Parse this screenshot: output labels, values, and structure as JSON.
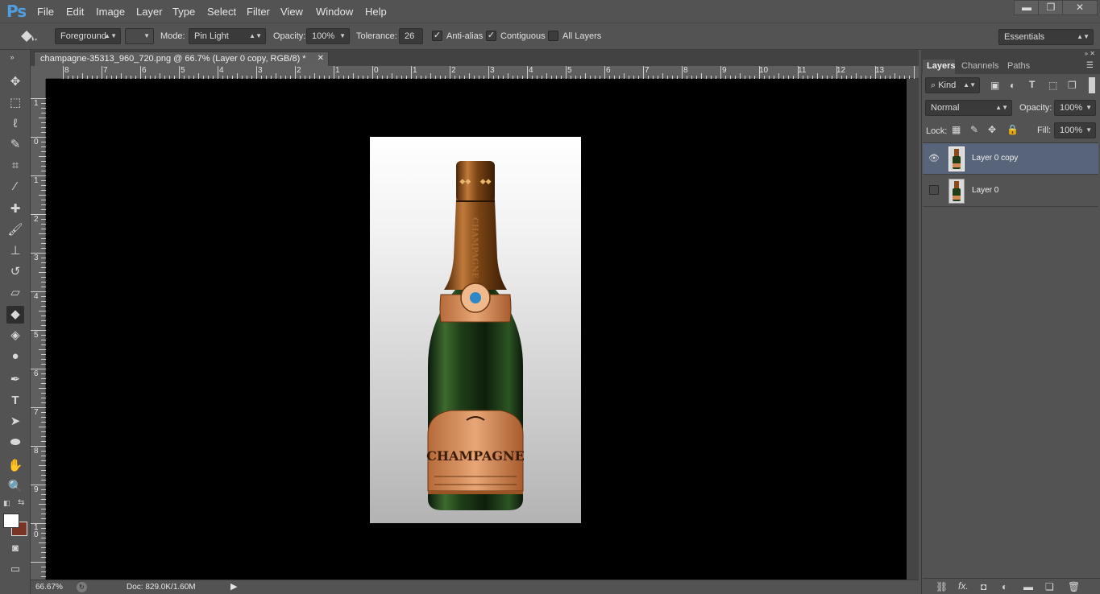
{
  "app": {
    "logo": "Ps"
  },
  "menu": [
    "File",
    "Edit",
    "Image",
    "Layer",
    "Type",
    "Select",
    "Filter",
    "View",
    "Window",
    "Help"
  ],
  "window_controls": {
    "minimize": "▬",
    "restore": "❐",
    "close": "✕"
  },
  "options": {
    "tool_icon": "paint-bucket-icon",
    "fill_source": "Foreground",
    "mode_label": "Mode:",
    "mode_value": "Pin Light",
    "opacity_label": "Opacity:",
    "opacity_value": "100%",
    "tolerance_label": "Tolerance:",
    "tolerance_value": "26",
    "antialias_label": "Anti-alias",
    "antialias_checked": true,
    "contiguous_label": "Contiguous",
    "contiguous_checked": true,
    "all_layers_label": "All Layers",
    "all_layers_checked": false,
    "workspace": "Essentials"
  },
  "document_tab": {
    "title": "champagne-35313_960_720.png @ 66.7% (Layer 0 copy, RGB/8) *",
    "close": "✕"
  },
  "ruler_top": [
    "8",
    "7",
    "6",
    "5",
    "4",
    "3",
    "2",
    "1",
    "0",
    "1",
    "2",
    "3",
    "4",
    "5",
    "6",
    "7",
    "8",
    "9",
    "10",
    "11",
    "12",
    "13"
  ],
  "ruler_left": [
    "1",
    "0",
    "1",
    "2",
    "3",
    "4",
    "5",
    "6",
    "7",
    "8",
    "9",
    "1\n0"
  ],
  "status": {
    "zoom": "66.67%",
    "doc": "Doc: 829.0K/1.60M"
  },
  "artwork": {
    "label_text": "CHAMPAGNE",
    "neck_text": "CHAMPAGNE"
  },
  "panel": {
    "tabs": [
      "Layers",
      "Channels",
      "Paths"
    ],
    "filter_kind": "Kind",
    "blend_mode": "Normal",
    "opacity_label": "Opacity:",
    "opacity_value": "100%",
    "lock_label": "Lock:",
    "fill_label": "Fill:",
    "fill_value": "100%",
    "layers": [
      {
        "name": "Layer 0 copy",
        "visible": true,
        "selected": true
      },
      {
        "name": "Layer 0",
        "visible": false,
        "selected": false
      }
    ]
  },
  "colors": {
    "foreground": "#ffffff",
    "background": "#7a3426",
    "selection": "#58647a"
  }
}
